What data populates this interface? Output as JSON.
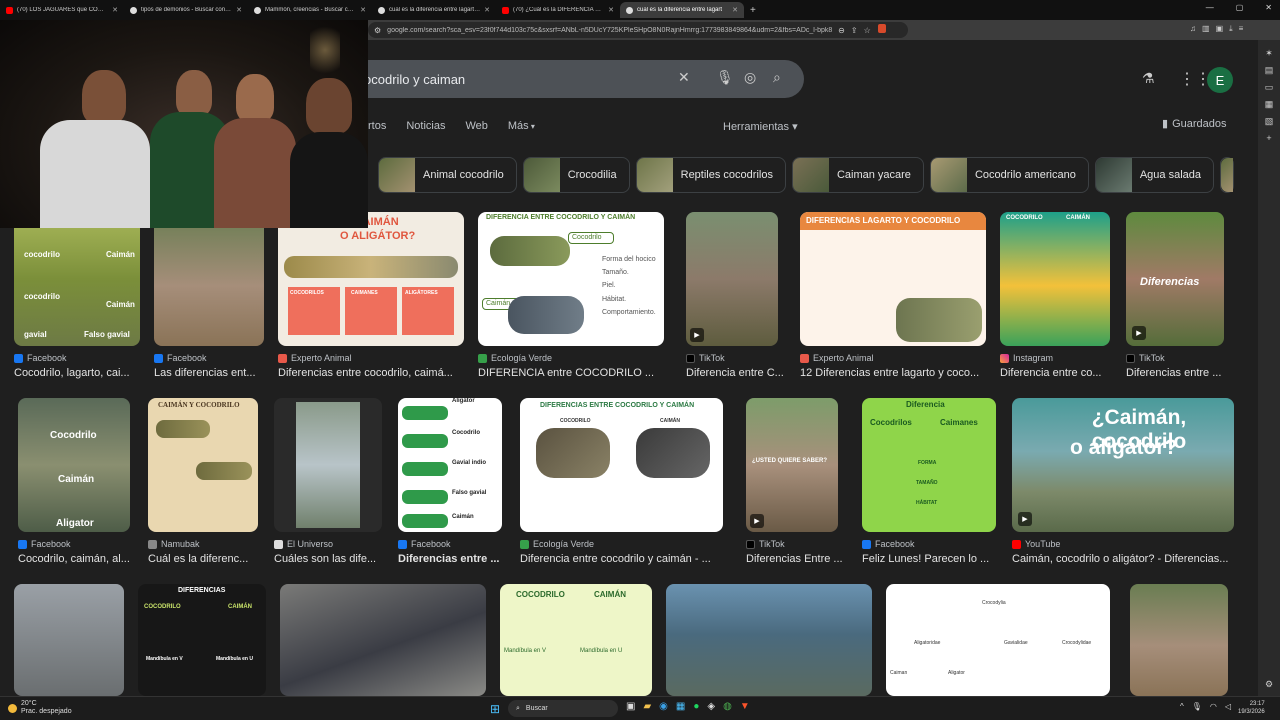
{
  "browser": {
    "tabs": [
      {
        "label": "(70) LOS JAGUARES que COMEN CO",
        "favicon": "youtube"
      },
      {
        "label": "tipos de demonios - Buscar con Goo",
        "favicon": "google"
      },
      {
        "label": "Mammón, creencias - Buscar con Go",
        "favicon": "google"
      },
      {
        "label": "cual es la diferencia entre lagarto co",
        "favicon": "google"
      },
      {
        "label": "(70) ¿Cuál es la DIFERENCIA entre C",
        "favicon": "youtube"
      },
      {
        "label": "cual es la diferencia entre lagart",
        "favicon": "google",
        "active": true
      }
    ],
    "new_tab": "+",
    "url": "google.com/search?sca_esv=23f0f744d103c75c&sxsrf=ANbL-n5DUcY725KPleSHpO8N0RajnHmrrg:1773983849864&udm=2&fbs=ADc_l-bpk8"
  },
  "search": {
    "query": "ocodrilo y caiman",
    "avatar_letter": "E",
    "nav": [
      "rtos",
      "Noticias",
      "Web",
      "Más"
    ],
    "tools": "Herramientas ▾",
    "saved": "Guardados"
  },
  "chips": [
    "Animal cocodrilo",
    "Crocodilia",
    "Reptiles cocodrilos",
    "Caiman yacare",
    "Cocodrilo americano",
    "Agua salada"
  ],
  "row1": [
    {
      "source": "Facebook",
      "title": "Cocodrilo, lagarto, cai...",
      "overlay": [
        "cocodrilo",
        "Caimán",
        "cocodrilo",
        "Caimán",
        "gavial",
        "Falso gavial"
      ]
    },
    {
      "source": "Facebook",
      "title": "Las diferencias ent..."
    },
    {
      "source": "Experto Animal",
      "title": "Diferencias entre cocodrilo, caimá...",
      "overlay": [
        "O, CAIMÁN",
        "O ALIGÁTOR?",
        "COCODRILOS",
        "CAIMANES",
        "ALIGÁTORES"
      ]
    },
    {
      "source": "Ecología Verde",
      "title": "DIFERENCIA entre COCODRILO ...",
      "overlay": [
        "DIFERENCIA ENTRE COCODRILO Y CAIMÁN",
        "Cocodrilo",
        "Forma del hocico",
        "Tamaño.",
        "Piel.",
        "Hábitat.",
        "Comportamiento.",
        "Caimán"
      ]
    },
    {
      "source": "TikTok",
      "title": "Diferencia entre C..."
    },
    {
      "source": "Experto Animal",
      "title": "12 Diferencias entre lagarto y coco...",
      "overlay": [
        "DIFERENCIAS LAGARTO Y COCODRILO"
      ]
    },
    {
      "source": "Instagram",
      "title": "Diferencia entre co...",
      "overlay": [
        "COCODRILO",
        "CAIMÁN"
      ]
    },
    {
      "source": "TikTok",
      "title": "Diferencias entre ...",
      "overlay": [
        "Diferencias"
      ]
    }
  ],
  "row2": [
    {
      "source": "Facebook",
      "title": "Cocodrilo, caimán, al...",
      "overlay": [
        "Cocodrilo",
        "Caimán",
        "Aligator"
      ]
    },
    {
      "source": "Namubak",
      "title": "Cuál es la diferenc...",
      "overlay": [
        "CAIMÁN Y COCODRILO"
      ]
    },
    {
      "source": "El Universo",
      "title": "Cuáles son las dife..."
    },
    {
      "source": "Facebook",
      "title": "Diferencias entre ...",
      "overlay": [
        "Aligátor",
        "Cocodrilo",
        "Gavial indio",
        "Falso gavial",
        "Caimán"
      ]
    },
    {
      "source": "Ecología Verde",
      "title": "Diferencia entre cocodrilo y caimán - ...",
      "overlay": [
        "DIFERENCIAS ENTRE COCODRILO Y CAIMÁN",
        "COCODRILO",
        "CAIMÁN"
      ]
    },
    {
      "source": "TikTok",
      "title": "Diferencias Entre ...",
      "overlay": [
        "¿USTED QUIERE SABER?"
      ]
    },
    {
      "source": "Facebook",
      "title": "Feliz Lunes! Parecen lo ...",
      "overlay": [
        "Diferencia",
        "Cocodrilos",
        "Caimanes",
        "FORMA",
        "TAMAÑO",
        "HÁBITAT"
      ]
    },
    {
      "source": "YouTube",
      "title": "Caimán, cocodrilo o aligátor? - Diferencias...",
      "overlay": [
        "¿Caimán, cocodrilo",
        "o aligátor?"
      ]
    }
  ],
  "row3": [
    {
      "overlay": []
    },
    {
      "overlay": [
        "DIFERENCIAS",
        "COCODRILO",
        "CAIMÁN",
        "Mandíbula en V",
        "Mandíbula en U"
      ]
    },
    {
      "overlay": []
    },
    {
      "overlay": [
        "COCODRILO",
        "CAIMÁN",
        "Mandíbula en V",
        "Mandíbula en U"
      ]
    },
    {
      "overlay": []
    },
    {
      "overlay": [
        "Crocodylia",
        "Aligatoridae",
        "Gavialidae",
        "Crocodylidae",
        "Caiman",
        "Aligator"
      ]
    },
    {
      "overlay": []
    }
  ],
  "taskbar": {
    "temp": "20°C",
    "weather": "Prac. despejado",
    "search": "Buscar",
    "time": "23:17",
    "date": "19/3/2026"
  },
  "colors": {
    "bg": "#1f1f1f",
    "searchbox": "#4d5156",
    "avatar": "#1a6f43"
  }
}
